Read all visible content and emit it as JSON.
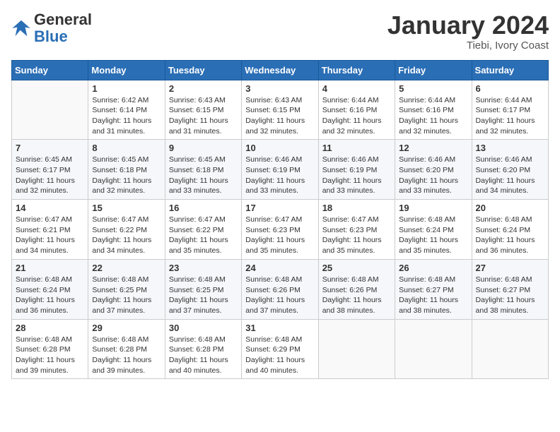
{
  "header": {
    "logo": {
      "general": "General",
      "blue": "Blue"
    },
    "title": "January 2024",
    "subtitle": "Tiebi, Ivory Coast"
  },
  "calendar": {
    "weekdays": [
      "Sunday",
      "Monday",
      "Tuesday",
      "Wednesday",
      "Thursday",
      "Friday",
      "Saturday"
    ],
    "weeks": [
      [
        {
          "day": null
        },
        {
          "day": "1",
          "sunrise": "6:42 AM",
          "sunset": "6:14 PM",
          "daylight": "11 hours and 31 minutes."
        },
        {
          "day": "2",
          "sunrise": "6:43 AM",
          "sunset": "6:15 PM",
          "daylight": "11 hours and 31 minutes."
        },
        {
          "day": "3",
          "sunrise": "6:43 AM",
          "sunset": "6:15 PM",
          "daylight": "11 hours and 32 minutes."
        },
        {
          "day": "4",
          "sunrise": "6:44 AM",
          "sunset": "6:16 PM",
          "daylight": "11 hours and 32 minutes."
        },
        {
          "day": "5",
          "sunrise": "6:44 AM",
          "sunset": "6:16 PM",
          "daylight": "11 hours and 32 minutes."
        },
        {
          "day": "6",
          "sunrise": "6:44 AM",
          "sunset": "6:17 PM",
          "daylight": "11 hours and 32 minutes."
        }
      ],
      [
        {
          "day": "7",
          "sunrise": "6:45 AM",
          "sunset": "6:17 PM",
          "daylight": "11 hours and 32 minutes."
        },
        {
          "day": "8",
          "sunrise": "6:45 AM",
          "sunset": "6:18 PM",
          "daylight": "11 hours and 32 minutes."
        },
        {
          "day": "9",
          "sunrise": "6:45 AM",
          "sunset": "6:18 PM",
          "daylight": "11 hours and 33 minutes."
        },
        {
          "day": "10",
          "sunrise": "6:46 AM",
          "sunset": "6:19 PM",
          "daylight": "11 hours and 33 minutes."
        },
        {
          "day": "11",
          "sunrise": "6:46 AM",
          "sunset": "6:19 PM",
          "daylight": "11 hours and 33 minutes."
        },
        {
          "day": "12",
          "sunrise": "6:46 AM",
          "sunset": "6:20 PM",
          "daylight": "11 hours and 33 minutes."
        },
        {
          "day": "13",
          "sunrise": "6:46 AM",
          "sunset": "6:20 PM",
          "daylight": "11 hours and 34 minutes."
        }
      ],
      [
        {
          "day": "14",
          "sunrise": "6:47 AM",
          "sunset": "6:21 PM",
          "daylight": "11 hours and 34 minutes."
        },
        {
          "day": "15",
          "sunrise": "6:47 AM",
          "sunset": "6:22 PM",
          "daylight": "11 hours and 34 minutes."
        },
        {
          "day": "16",
          "sunrise": "6:47 AM",
          "sunset": "6:22 PM",
          "daylight": "11 hours and 35 minutes."
        },
        {
          "day": "17",
          "sunrise": "6:47 AM",
          "sunset": "6:23 PM",
          "daylight": "11 hours and 35 minutes."
        },
        {
          "day": "18",
          "sunrise": "6:47 AM",
          "sunset": "6:23 PM",
          "daylight": "11 hours and 35 minutes."
        },
        {
          "day": "19",
          "sunrise": "6:48 AM",
          "sunset": "6:24 PM",
          "daylight": "11 hours and 35 minutes."
        },
        {
          "day": "20",
          "sunrise": "6:48 AM",
          "sunset": "6:24 PM",
          "daylight": "11 hours and 36 minutes."
        }
      ],
      [
        {
          "day": "21",
          "sunrise": "6:48 AM",
          "sunset": "6:24 PM",
          "daylight": "11 hours and 36 minutes."
        },
        {
          "day": "22",
          "sunrise": "6:48 AM",
          "sunset": "6:25 PM",
          "daylight": "11 hours and 37 minutes."
        },
        {
          "day": "23",
          "sunrise": "6:48 AM",
          "sunset": "6:25 PM",
          "daylight": "11 hours and 37 minutes."
        },
        {
          "day": "24",
          "sunrise": "6:48 AM",
          "sunset": "6:26 PM",
          "daylight": "11 hours and 37 minutes."
        },
        {
          "day": "25",
          "sunrise": "6:48 AM",
          "sunset": "6:26 PM",
          "daylight": "11 hours and 38 minutes."
        },
        {
          "day": "26",
          "sunrise": "6:48 AM",
          "sunset": "6:27 PM",
          "daylight": "11 hours and 38 minutes."
        },
        {
          "day": "27",
          "sunrise": "6:48 AM",
          "sunset": "6:27 PM",
          "daylight": "11 hours and 38 minutes."
        }
      ],
      [
        {
          "day": "28",
          "sunrise": "6:48 AM",
          "sunset": "6:28 PM",
          "daylight": "11 hours and 39 minutes."
        },
        {
          "day": "29",
          "sunrise": "6:48 AM",
          "sunset": "6:28 PM",
          "daylight": "11 hours and 39 minutes."
        },
        {
          "day": "30",
          "sunrise": "6:48 AM",
          "sunset": "6:28 PM",
          "daylight": "11 hours and 40 minutes."
        },
        {
          "day": "31",
          "sunrise": "6:48 AM",
          "sunset": "6:29 PM",
          "daylight": "11 hours and 40 minutes."
        },
        {
          "day": null
        },
        {
          "day": null
        },
        {
          "day": null
        }
      ]
    ]
  }
}
